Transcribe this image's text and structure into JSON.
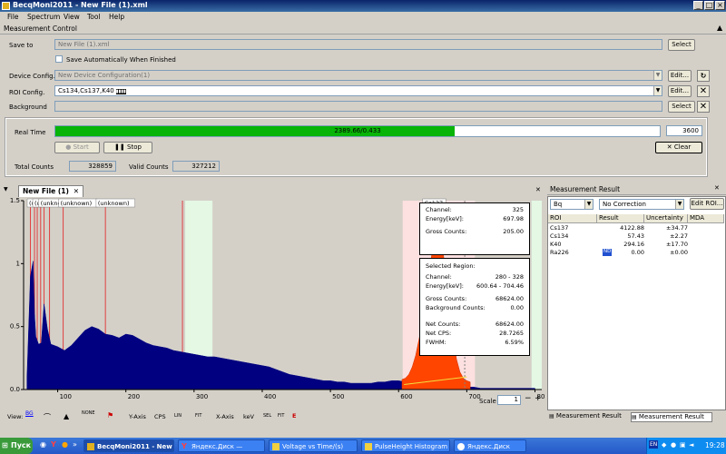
{
  "window": {
    "title": "BecqMoni2011 - New File (1).xml"
  },
  "menu": [
    "File",
    "Spectrum",
    "View",
    "Tool",
    "Help"
  ],
  "measurement_control": {
    "header": "Measurement Control",
    "save_to_label": "Save to",
    "save_to_value": "New File (1).xml",
    "select_label": "Select",
    "save_auto_label": "Save Automatically When Finished",
    "device_config_label": "Device Config.",
    "device_config_value": "New Device Configuration(1)",
    "edit_label": "Edit...",
    "roi_config_label": "ROI Config.",
    "roi_config_value": "Cs134,Cs137,K40",
    "background_label": "Background",
    "real_time_label": "Real Time",
    "progress_text": "2389.66/0.433",
    "progress_fraction": 0.66,
    "time_value": "3600",
    "start_label": "Start",
    "stop_label": "Stop",
    "clear_label": "Clear",
    "total_counts_label": "Total Counts",
    "total_counts_value": "328859",
    "valid_counts_label": "Valid Counts",
    "valid_counts_value": "327212"
  },
  "spectrum_tab": {
    "label": "New File (1)"
  },
  "chart_data": {
    "type": "area",
    "x_tick_labels": [
      "100",
      "200",
      "300",
      "400",
      "500",
      "600",
      "700",
      "800"
    ],
    "y_tick_labels": [
      "0.0",
      "0.5",
      "1",
      "1.5"
    ],
    "y_ticks": [
      0,
      0.5,
      1.0,
      1.5
    ],
    "x_ticks": [
      100,
      200,
      300,
      400,
      500,
      600,
      700,
      800
    ],
    "xlim": [
      50,
      810
    ],
    "ylim": [
      0,
      1.5
    ],
    "series": [
      {
        "color": "#000080",
        "x": [
          55,
          60,
          64,
          66,
          68,
          72,
          76,
          80,
          85,
          90,
          100,
          110,
          120,
          130,
          140,
          150,
          160,
          170,
          180,
          190,
          200,
          210,
          220,
          230,
          240,
          250,
          260,
          270,
          280,
          290,
          300,
          310,
          320,
          330,
          340,
          350,
          360,
          370,
          380,
          390,
          400,
          410,
          420,
          430,
          440,
          450,
          460,
          470,
          480,
          490,
          500,
          510,
          520,
          530,
          540,
          550,
          560,
          570,
          580,
          590,
          600,
          610,
          620,
          630,
          640,
          650,
          660,
          670,
          680,
          690,
          700,
          710,
          720,
          730,
          740,
          760,
          780,
          800
        ],
        "y": [
          0.1,
          0.9,
          1.02,
          0.6,
          0.42,
          0.36,
          0.37,
          0.68,
          0.48,
          0.36,
          0.34,
          0.31,
          0.35,
          0.41,
          0.47,
          0.5,
          0.48,
          0.44,
          0.43,
          0.41,
          0.44,
          0.43,
          0.4,
          0.37,
          0.35,
          0.34,
          0.33,
          0.31,
          0.3,
          0.29,
          0.28,
          0.27,
          0.26,
          0.26,
          0.25,
          0.24,
          0.23,
          0.22,
          0.21,
          0.2,
          0.19,
          0.18,
          0.16,
          0.14,
          0.12,
          0.11,
          0.1,
          0.09,
          0.08,
          0.07,
          0.07,
          0.06,
          0.06,
          0.05,
          0.05,
          0.05,
          0.05,
          0.06,
          0.06,
          0.07,
          0.07,
          0.06,
          0.05,
          0.05,
          0.05,
          0.05,
          0.04,
          0.03,
          0.02,
          0.02,
          0.02,
          0.02,
          0.01,
          0.01,
          0.01,
          0.01,
          0.01,
          0.01
        ]
      }
    ],
    "roi_peak": {
      "color": "#ff4500",
      "x": [
        605,
        610,
        615,
        620,
        625,
        630,
        635,
        640,
        645,
        650,
        655,
        660,
        665,
        670,
        675,
        680,
        685,
        690,
        695,
        700,
        705
      ],
      "y": [
        0.08,
        0.09,
        0.12,
        0.18,
        0.27,
        0.4,
        0.55,
        0.75,
        0.95,
        1.12,
        1.23,
        1.24,
        1.1,
        0.9,
        0.65,
        0.42,
        0.24,
        0.14,
        0.09,
        0.07,
        0.06
      ]
    },
    "roi_labels": [
      "(un",
      "(un",
      "(unknown)",
      "(unknown)",
      "(unknown)",
      "Cs137"
    ],
    "roi_lines_x": [
      60,
      66,
      70,
      75,
      80,
      88,
      108,
      170,
      283
    ],
    "green_bands": [
      [
        287,
        327
      ],
      [
        795,
        810
      ]
    ],
    "pink_band": [
      606,
      712
    ],
    "scale_label": "Scale",
    "scale_value": "1"
  },
  "channel_info": {
    "channel_label": "Channel:",
    "channel_value": "325",
    "energy_label": "Energy[keV]:",
    "energy_value": "697.98",
    "gross_label": "Gross Counts:",
    "gross_value": "205.00"
  },
  "region_info": {
    "header": "Selected Region:",
    "channel_label": "Channel:",
    "channel_value": "280 - 328",
    "energy_label": "Energy[keV]:",
    "energy_value": "600.64 - 704.46",
    "gross_label": "Gross Counts:",
    "gross_value": "68624.00",
    "bg_label": "Background Counts:",
    "bg_value": "0.00",
    "net_label": "Net Counts:",
    "net_value": "68624.00",
    "cps_label": "Net CPS:",
    "cps_value": "28.7265",
    "fwhm_label": "FWHM:",
    "fwhm_value": "6.59%"
  },
  "measurement_result": {
    "header": "Measurement Result",
    "unit": "Bq",
    "correction": "No Correction",
    "edit_roi_label": "Edit ROI...",
    "columns": [
      "ROI",
      "Result",
      "Uncertainty",
      "MDA"
    ],
    "rows": [
      {
        "roi": "Cs137",
        "result": "4122.88",
        "uncertainty": "±34.77"
      },
      {
        "roi": "Cs134",
        "result": "57.43",
        "uncertainty": "±2.27"
      },
      {
        "roi": "K40",
        "result": "294.16",
        "uncertainty": "±17.70"
      },
      {
        "roi": "Ra226",
        "result": "0.00",
        "uncertainty": "±0.00",
        "badge": "ND"
      }
    ],
    "bottom_tabs": [
      "Measurement Result",
      "Measurement Result"
    ]
  },
  "bottom_toolbar": {
    "view_label": "View:",
    "bg_label": "BG",
    "none_label": "NONE",
    "yaxis_label": "Y-Axis",
    "cps_label": "CPS",
    "lin_label": "LIN",
    "fit_label": "FIT",
    "xaxis_label": "X-Axis",
    "kev_label": "keV",
    "sel_label": "SEL",
    "fit2_label": "FIT",
    "e_label": "E"
  },
  "taskbar": {
    "start_label": "Пуск",
    "tasks": [
      {
        "label": "BecqMoni2011 - New ..."
      },
      {
        "label": "Яндекс.Диск — Yandex"
      },
      {
        "label": "Voltage vs Time/(s)"
      },
      {
        "label": "PulseHeight Histogram"
      },
      {
        "label": "Яндекс.Диск"
      }
    ],
    "lang": "EN",
    "clock": "19:28"
  }
}
